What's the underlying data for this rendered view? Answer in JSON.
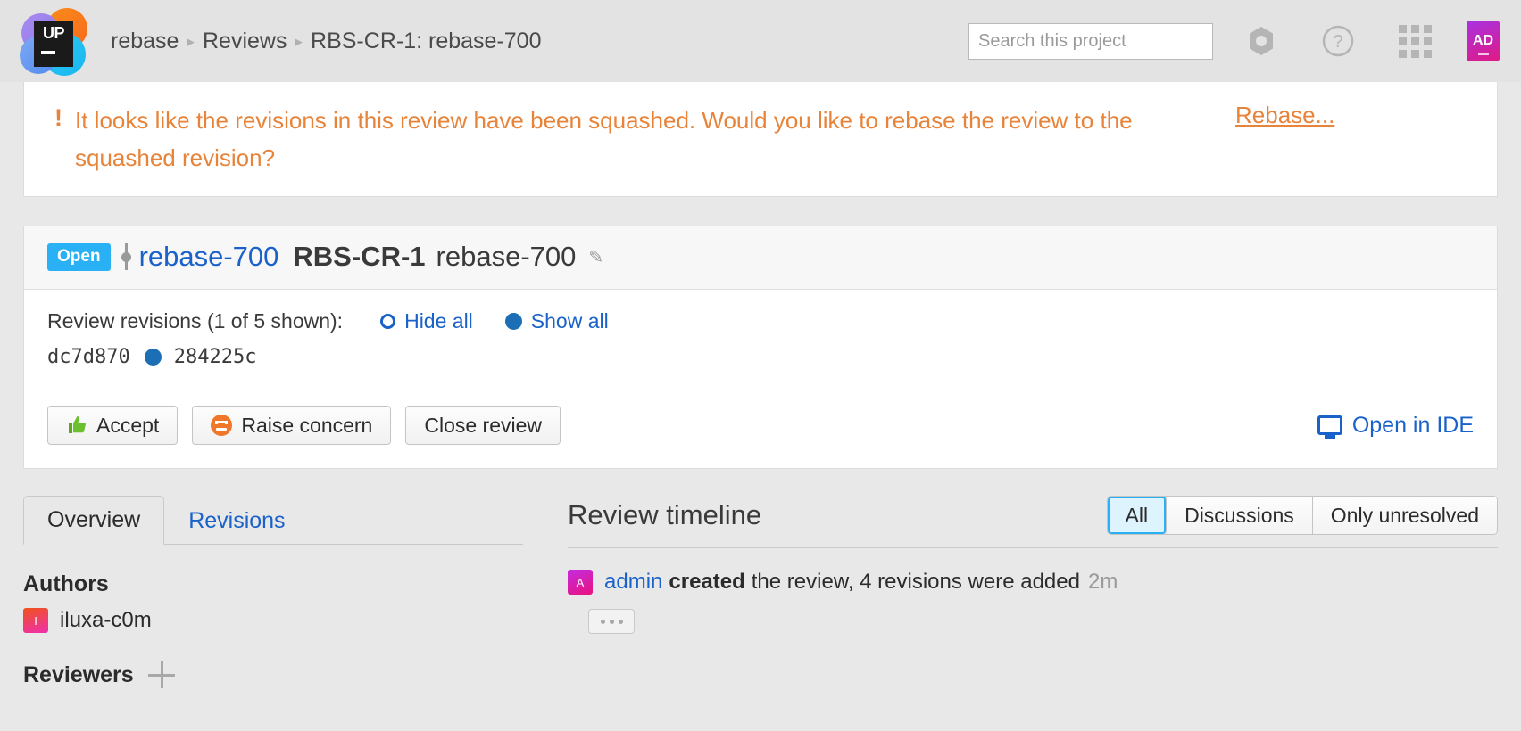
{
  "header": {
    "logo_text": "UP",
    "breadcrumb": [
      {
        "label": "rebase"
      },
      {
        "label": "Reviews"
      },
      {
        "label": "RBS-CR-1: rebase-700"
      }
    ],
    "separator": "▸",
    "search": {
      "value": "",
      "placeholder": "Search this project"
    },
    "icons": {
      "settings": "gear-icon",
      "help": "help-icon",
      "apps": "apps-grid-icon"
    },
    "avatar": {
      "initials": "AD"
    }
  },
  "banner": {
    "bang": "!",
    "message": "It looks like the revisions in this review have been squashed. Would you like to rebase the review to the squashed revision?",
    "action_label": "Rebase...",
    "accent_color": "#e8833a"
  },
  "review": {
    "status_badge": "Open",
    "branch": "rebase-700",
    "id": "RBS-CR-1",
    "title": "rebase-700",
    "edit_icon": "✎",
    "revisions_label": "Review revisions (1 of 5 shown):",
    "hide_all_label": "Hide all",
    "show_all_label": "Show all",
    "revisions": [
      {
        "hash": "dc7d870",
        "shown": false
      },
      {
        "hash": "284225c",
        "shown": true
      }
    ],
    "buttons": [
      {
        "label": "Accept",
        "icon": "thumbs-up-icon"
      },
      {
        "label": "Raise concern",
        "icon": "concern-face-icon"
      },
      {
        "label": "Close review",
        "icon": ""
      }
    ],
    "open_in_ide_label": "Open in IDE"
  },
  "sidebar": {
    "tabs": [
      {
        "label": "Overview",
        "active": true
      },
      {
        "label": "Revisions",
        "active": false
      }
    ],
    "authors_heading": "Authors",
    "authors": [
      {
        "name": "iluxa-c0m",
        "initial": "I"
      }
    ],
    "reviewers_heading": "Reviewers"
  },
  "timeline": {
    "title": "Review timeline",
    "filters": [
      {
        "label": "All",
        "active": true
      },
      {
        "label": "Discussions",
        "active": false
      },
      {
        "label": "Only unresolved",
        "active": false
      }
    ],
    "entries": [
      {
        "initial": "A",
        "who": "admin",
        "action": "created",
        "text": "the review, 4 revisions were added",
        "time": "2m"
      }
    ],
    "more_label": "…"
  }
}
